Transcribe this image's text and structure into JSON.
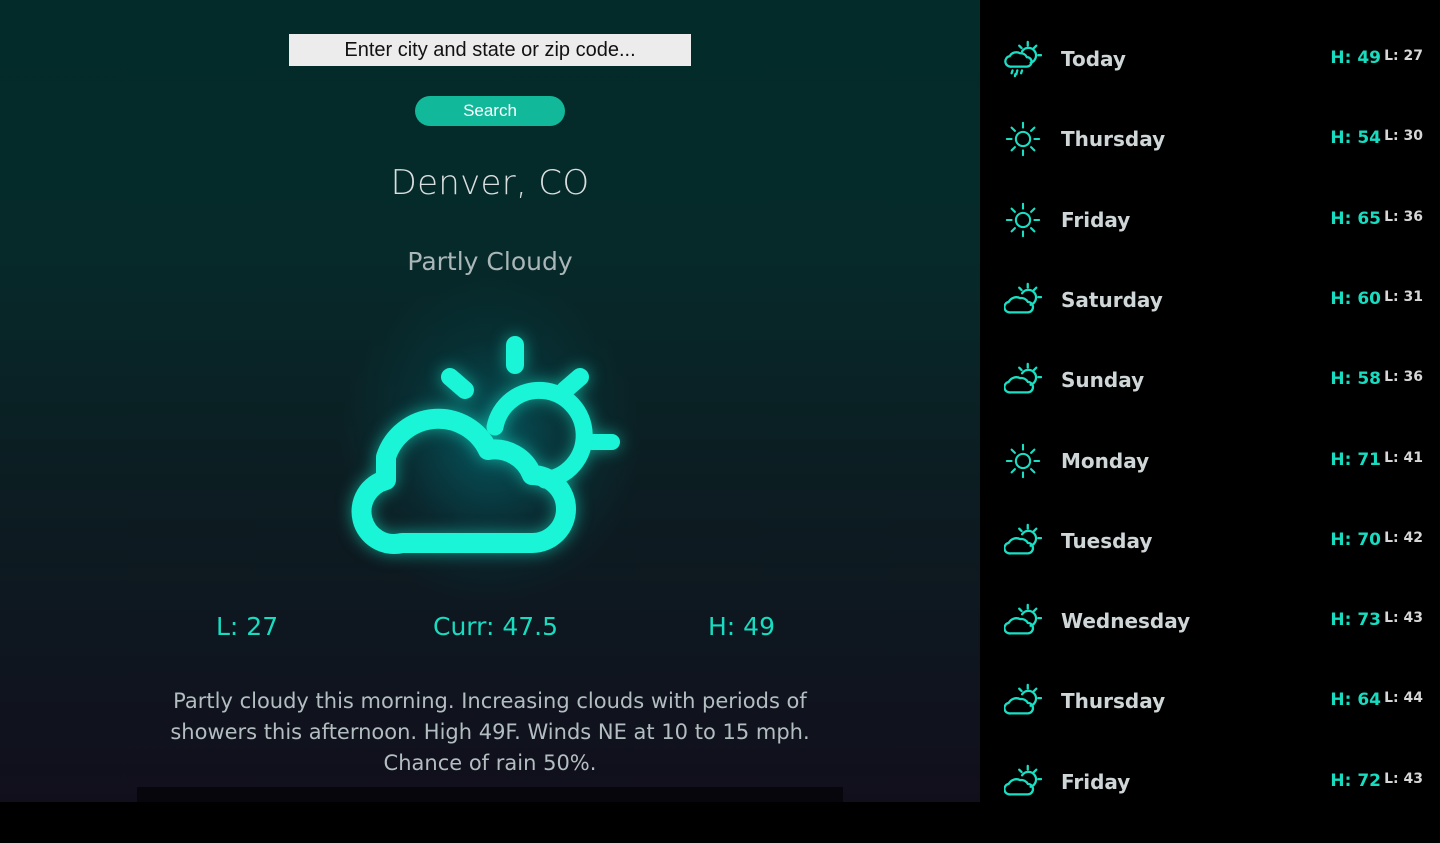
{
  "search": {
    "placeholder": "Enter city and state or zip code...",
    "value": "",
    "button_label": "Search"
  },
  "current": {
    "city": "Denver, CO",
    "condition": "Partly Cloudy",
    "icon": "partly-cloudy-icon",
    "low": "L: 27",
    "curr": "Curr: 47.5",
    "high": "H: 49",
    "description": "Partly cloudy this morning. Increasing clouds with periods of showers this afternoon. High 49F. Winds NE at 10 to 15 mph. Chance of rain 50%."
  },
  "colors": {
    "accent": "#18dcc0",
    "button": "#12b89a",
    "sidebar_bg": "#000000"
  },
  "forecast": [
    {
      "day": "Today",
      "icon": "rain-cloud-icon",
      "high": "H: 49",
      "low": "L: 27"
    },
    {
      "day": "Thursday",
      "icon": "sun-icon",
      "high": "H: 54",
      "low": "L: 30"
    },
    {
      "day": "Friday",
      "icon": "sun-icon",
      "high": "H: 65",
      "low": "L: 36"
    },
    {
      "day": "Saturday",
      "icon": "partly-cloudy-icon",
      "high": "H: 60",
      "low": "L: 31"
    },
    {
      "day": "Sunday",
      "icon": "partly-cloudy-icon",
      "high": "H: 58",
      "low": "L: 36"
    },
    {
      "day": "Monday",
      "icon": "sun-icon",
      "high": "H: 71",
      "low": "L: 41"
    },
    {
      "day": "Tuesday",
      "icon": "partly-cloudy-icon",
      "high": "H: 70",
      "low": "L: 42"
    },
    {
      "day": "Wednesday",
      "icon": "partly-cloudy-icon",
      "high": "H: 73",
      "low": "L: 43"
    },
    {
      "day": "Thursday",
      "icon": "partly-cloudy-icon",
      "high": "H: 64",
      "low": "L: 44"
    },
    {
      "day": "Friday",
      "icon": "partly-cloudy-icon",
      "high": "H: 72",
      "low": "L: 43"
    }
  ]
}
